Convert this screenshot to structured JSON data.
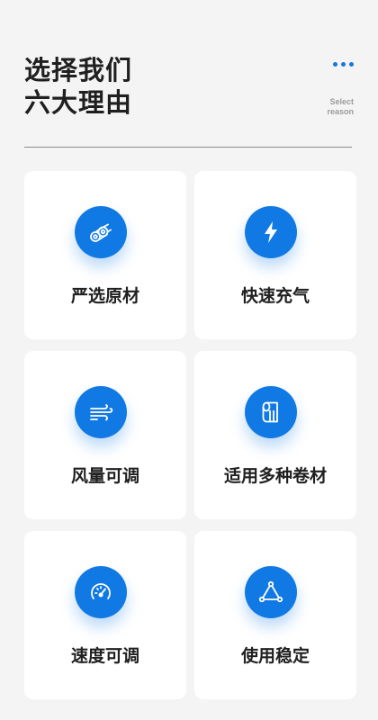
{
  "header": {
    "title_line1": "选择我们",
    "title_line2": "六大理由",
    "subtitle_line1": "Select",
    "subtitle_line2": "reason",
    "more_icon": "more-dots-icon",
    "accent_color": "#1677d9"
  },
  "cards": [
    {
      "label": "严选原材",
      "icon": "material-rolls-icon"
    },
    {
      "label": "快速充气",
      "icon": "lightning-icon"
    },
    {
      "label": "风量可调",
      "icon": "wind-icon"
    },
    {
      "label": "适用多种卷材",
      "icon": "paper-roll-icon"
    },
    {
      "label": "速度可调",
      "icon": "speedometer-icon"
    },
    {
      "label": "使用稳定",
      "icon": "triangle-stability-icon"
    }
  ],
  "colors": {
    "background": "#f4f4f4",
    "card": "#ffffff",
    "icon_circle": "#1179e3",
    "text": "#202020"
  }
}
